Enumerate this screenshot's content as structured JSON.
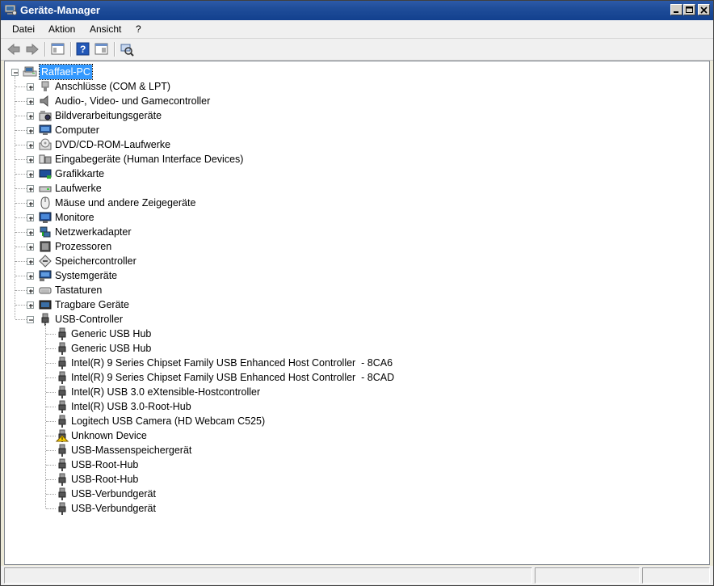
{
  "window": {
    "title": "Geräte-Manager"
  },
  "menu": [
    "Datei",
    "Aktion",
    "Ansicht",
    "?"
  ],
  "toolbar": {
    "buttons": [
      "back-arrow-icon",
      "forward-arrow-icon",
      "console-tree-icon",
      "help-icon",
      "properties-pane-icon",
      "scan-hardware-icon"
    ]
  },
  "tree": {
    "root": "Raffael-PC",
    "categories": [
      {
        "label": "Anschlüsse (COM & LPT)",
        "icon": "port-icon"
      },
      {
        "label": "Audio-, Video- und Gamecontroller",
        "icon": "speaker-icon"
      },
      {
        "label": "Bildverarbeitungsgeräte",
        "icon": "camera-icon"
      },
      {
        "label": "Computer",
        "icon": "computer-icon"
      },
      {
        "label": "DVD/CD-ROM-Laufwerke",
        "icon": "cdrom-icon"
      },
      {
        "label": "Eingabegeräte (Human Interface Devices)",
        "icon": "hid-icon"
      },
      {
        "label": "Grafikkarte",
        "icon": "display-adapter-icon"
      },
      {
        "label": "Laufwerke",
        "icon": "disk-drive-icon"
      },
      {
        "label": "Mäuse und andere Zeigegeräte",
        "icon": "mouse-icon"
      },
      {
        "label": "Monitore",
        "icon": "monitor-icon"
      },
      {
        "label": "Netzwerkadapter",
        "icon": "network-icon"
      },
      {
        "label": "Prozessoren",
        "icon": "cpu-icon"
      },
      {
        "label": "Speichercontroller",
        "icon": "storage-controller-icon"
      },
      {
        "label": "Systemgeräte",
        "icon": "system-device-icon"
      },
      {
        "label": "Tastaturen",
        "icon": "keyboard-icon"
      },
      {
        "label": "Tragbare Geräte",
        "icon": "portable-device-icon"
      },
      {
        "label": "USB-Controller",
        "icon": "usb-icon",
        "expanded": true
      }
    ],
    "usb_children": [
      {
        "label": "Generic USB Hub"
      },
      {
        "label": "Generic USB Hub"
      },
      {
        "label": "Intel(R) 9 Series Chipset Family USB Enhanced Host Controller  - 8CA6"
      },
      {
        "label": "Intel(R) 9 Series Chipset Family USB Enhanced Host Controller  - 8CAD"
      },
      {
        "label": "Intel(R) USB 3.0 eXtensible-Hostcontroller"
      },
      {
        "label": "Intel(R) USB 3.0-Root-Hub"
      },
      {
        "label": "Logitech USB Camera (HD Webcam C525)"
      },
      {
        "label": "Unknown Device",
        "warning": true
      },
      {
        "label": "USB-Massenspeichergerät"
      },
      {
        "label": "USB-Root-Hub"
      },
      {
        "label": "USB-Root-Hub"
      },
      {
        "label": "USB-Verbundgerät"
      },
      {
        "label": "USB-Verbundgerät"
      }
    ]
  },
  "colors": {
    "selection": "#3399ff",
    "titlebar": "#1f4d99"
  }
}
